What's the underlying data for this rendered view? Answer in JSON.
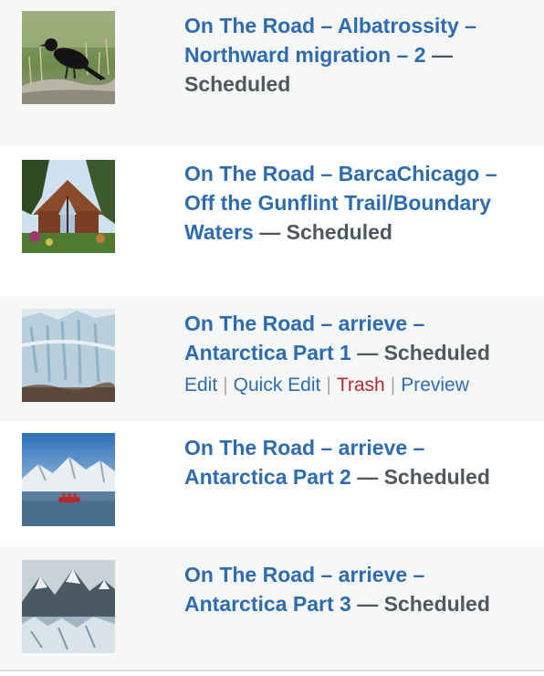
{
  "posts": [
    {
      "title_line1": "On The Road – Albatrossity –",
      "title_line2": "Northward migration – 2",
      "status": "Scheduled",
      "thumbnail": "blackbird-photo"
    },
    {
      "title_line1": "On The Road – BarcaChicago –",
      "title_line2": "Off the Gunflint Trail/Boundary",
      "title_line3": "Waters",
      "status": "Scheduled",
      "thumbnail": "log-cabin-photo"
    },
    {
      "title_line1": "On The Road – arrieve –",
      "title_line2": "Antarctica Part 1",
      "status": "Scheduled",
      "thumbnail": "glacier-photo",
      "actions": {
        "edit": "Edit",
        "quick_edit": "Quick Edit",
        "trash": "Trash",
        "preview": "Preview",
        "separator": "|"
      }
    },
    {
      "title_line1": "On The Road – arrieve –",
      "title_line2": "Antarctica Part 2",
      "status": "Scheduled",
      "thumbnail": "zodiac-boat-photo"
    },
    {
      "title_line1": "On The Road – arrieve –",
      "title_line2": "Antarctica Part 3",
      "status": "Scheduled",
      "thumbnail": "ice-mountains-photo"
    }
  ],
  "em_dash": "—",
  "colors": {
    "link": "#2f6cae",
    "status": "#50575e",
    "trash": "#b32d2e",
    "alt_row": "#f6f7f7"
  }
}
